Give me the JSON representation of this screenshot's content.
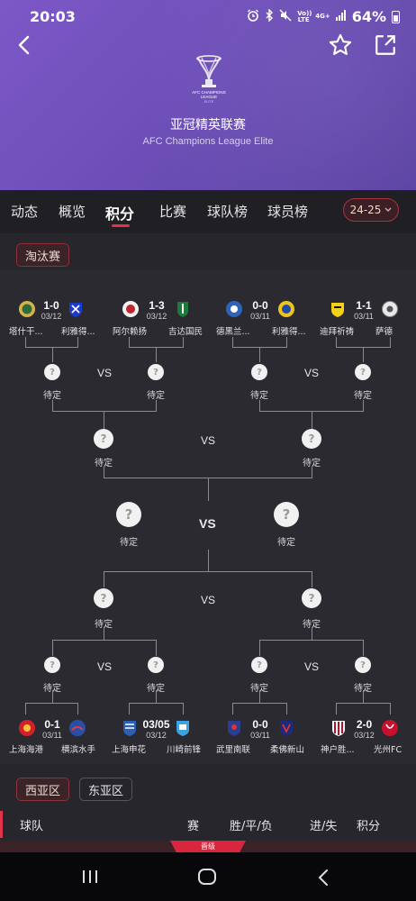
{
  "status_bar": {
    "time": "20:03",
    "battery": "64%",
    "net": {
      "volte": "Vo)) LTE",
      "speed": "4G+"
    }
  },
  "header": {
    "title_cn": "亚冠精英联赛",
    "title_en": "AFC Champions League Elite",
    "logo_text": "AFC CHAMPIONS LEAGUE ELITE"
  },
  "tabs": [
    {
      "label": "动态",
      "active": false
    },
    {
      "label": "概览",
      "active": false
    },
    {
      "label": "积分",
      "active": true
    },
    {
      "label": "比赛",
      "active": false
    },
    {
      "label": "球队榜",
      "active": false
    },
    {
      "label": "球员榜",
      "active": false
    }
  ],
  "season": "24-25",
  "knockout_label": "淘汰赛",
  "pending": "待定",
  "vs": "VS",
  "top_matches": [
    {
      "score": "1-0",
      "date": "03/12",
      "home": "塔什干...",
      "away": "利雅得...",
      "home_icon": "pakhtakor-crest-icon",
      "away_icon": "al-hilal-crest-icon"
    },
    {
      "score": "1-3",
      "date": "03/12",
      "home": "阿尔赖扬",
      "away": "吉达国民",
      "home_icon": "al-rayyan-crest-icon",
      "away_icon": "al-ahli-crest-icon"
    },
    {
      "score": "0-0",
      "date": "03/11",
      "home": "德黑兰...",
      "away": "利雅得...",
      "home_icon": "esteghlal-crest-icon",
      "away_icon": "al-nassr-crest-icon"
    },
    {
      "score": "1-1",
      "date": "03/11",
      "home": "迪拜祈祷",
      "away": "萨德",
      "home_icon": "al-wasl-crest-icon",
      "away_icon": "al-sadd-crest-icon"
    }
  ],
  "bottom_matches": [
    {
      "score": "0-1",
      "date": "03/11",
      "home": "上海海港",
      "away": "横滨水手",
      "home_icon": "shanghai-port-crest-icon",
      "away_icon": "yokohama-marinos-crest-icon"
    },
    {
      "score": "03/05",
      "date": "03/12",
      "home": "上海申花",
      "away": "川崎前锋",
      "home_icon": "shanghai-shenhua-crest-icon",
      "away_icon": "kawasaki-frontale-crest-icon"
    },
    {
      "score": "0-0",
      "date": "03/11",
      "home": "武里南联",
      "away": "柔佛新山",
      "home_icon": "buriram-crest-icon",
      "away_icon": "johor-crest-icon"
    },
    {
      "score": "2-0",
      "date": "03/12",
      "home": "神户胜...",
      "away": "光州FC",
      "home_icon": "vissel-kobe-crest-icon",
      "away_icon": "gwangju-crest-icon"
    }
  ],
  "region_tabs": [
    {
      "label": "西亚区",
      "active": true
    },
    {
      "label": "东亚区",
      "active": false
    }
  ],
  "table_headers": {
    "team": "球队",
    "played": "赛",
    "wdl": "胜/平/负",
    "goals": "进/失",
    "points": "积分"
  },
  "section_badge": "晋级",
  "colors": {
    "accent": "#e2334b",
    "header_purple": "#6e4fb8",
    "bg": "#25252b"
  }
}
